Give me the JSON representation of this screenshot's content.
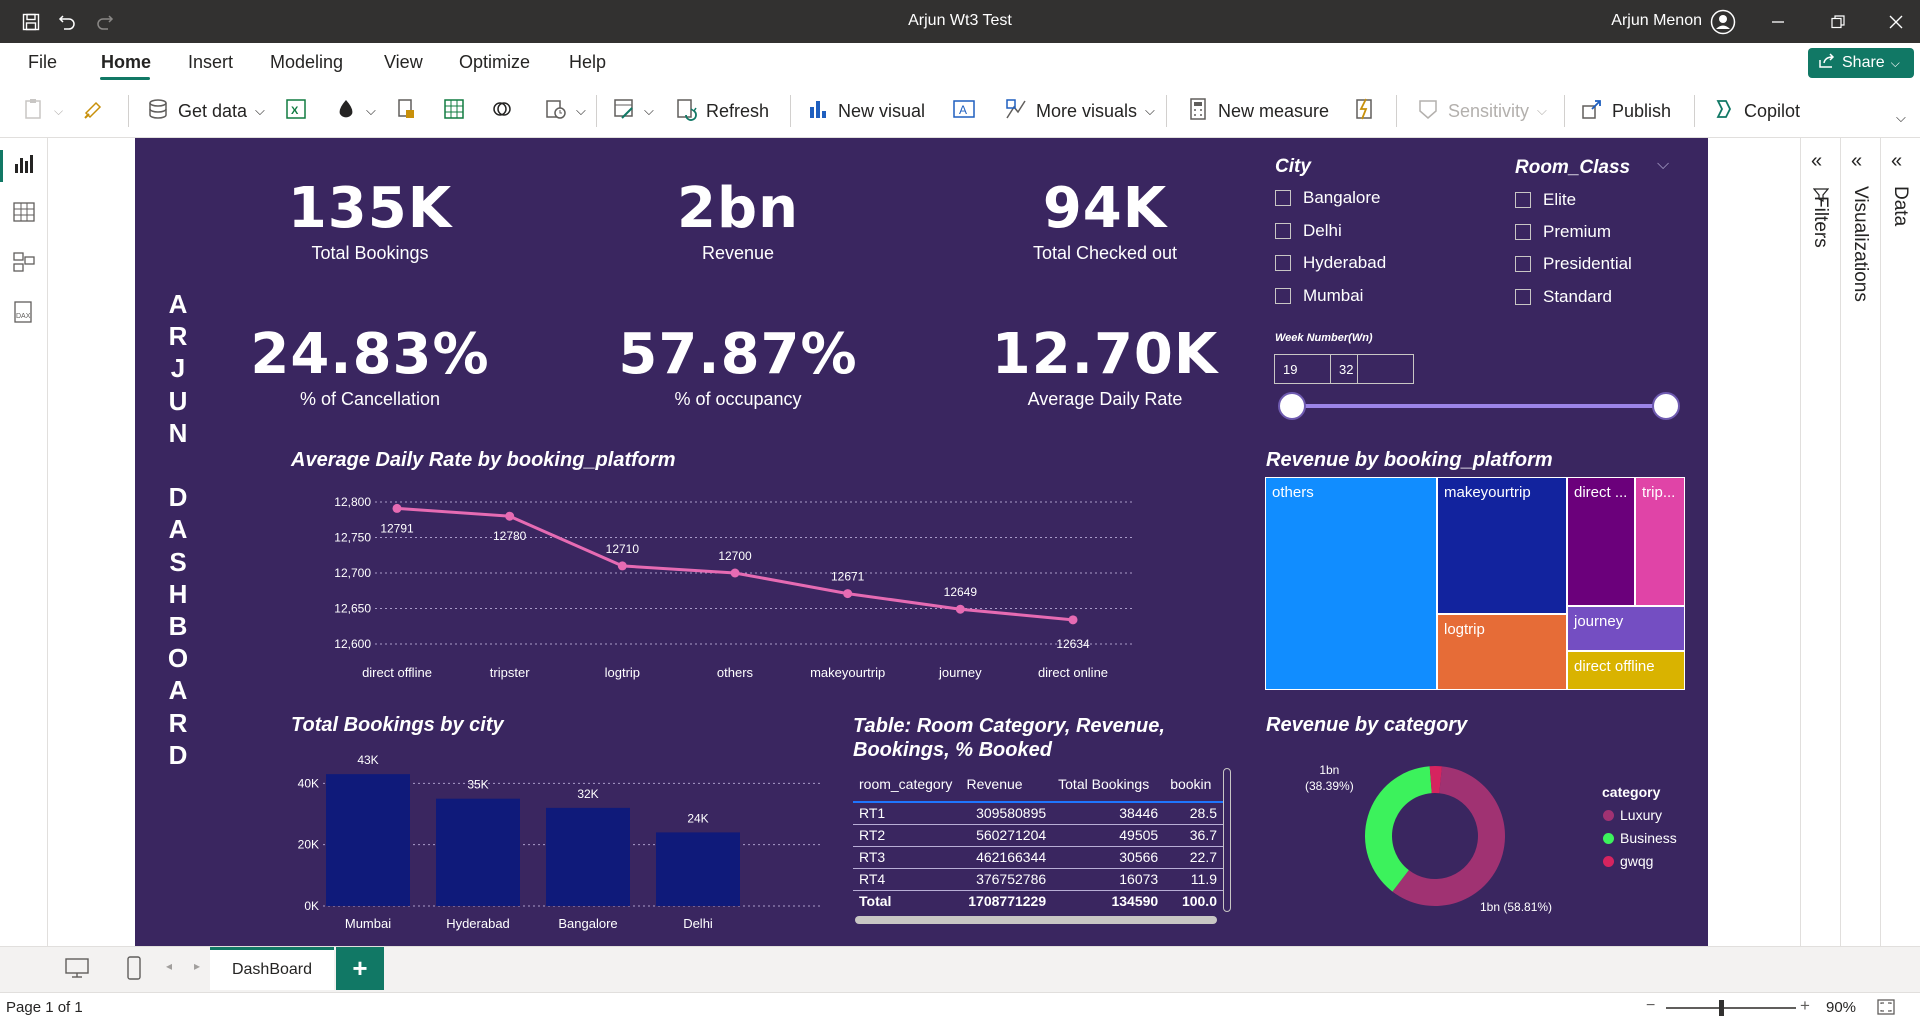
{
  "window": {
    "title": "Arjun Wt3 Test",
    "user": "Arjun Menon"
  },
  "menu": {
    "items": [
      "File",
      "Home",
      "Insert",
      "Modeling",
      "View",
      "Optimize",
      "Help"
    ],
    "active": "Home",
    "share_label": "Share"
  },
  "ribbon": {
    "get_data": "Get data",
    "refresh": "Refresh",
    "new_visual": "New visual",
    "more_visuals": "More visuals",
    "new_measure": "New measure",
    "sensitivity": "Sensitivity",
    "publish": "Publish",
    "copilot": "Copilot"
  },
  "dashboard": {
    "vertical_title": "A\nR\nJ\nU\nN\n\nD\nA\nS\nH\nB\nO\nA\nR\nD",
    "kpis": {
      "total_bookings": {
        "value": "135K",
        "label": "Total Bookings"
      },
      "revenue": {
        "value": "2bn",
        "label": "Revenue"
      },
      "checked_out": {
        "value": "94K",
        "label": "Total Checked out"
      },
      "cancellation": {
        "value": "24.83%",
        "label": "% of Cancellation"
      },
      "occupancy": {
        "value": "57.87%",
        "label": "% of occupancy"
      },
      "adr": {
        "value": "12.70K",
        "label": "Average Daily Rate"
      }
    },
    "slicers": {
      "city": {
        "title": "City",
        "items": [
          "Bangalore",
          "Delhi",
          "Hyderabad",
          "Mumbai"
        ]
      },
      "room_class": {
        "title": "Room_Class",
        "items": [
          "Elite",
          "Premium",
          "Presidential",
          "Standard"
        ]
      },
      "week": {
        "label": "Week Number(Wn)",
        "min": "19",
        "max": "32"
      }
    },
    "line_title": "Average Daily Rate by booking_platform",
    "treemap_title": "Revenue by booking_platform",
    "treemap_labels": [
      "others",
      "makeyourtrip",
      "direct ...",
      "trip...",
      "logtrip",
      "journey",
      "direct offline"
    ],
    "bar_title": "Total Bookings by city",
    "table": {
      "title": "Table: Room Category, Revenue, Bookings, % Booked",
      "headers": [
        "room_category",
        "Revenue",
        "Total Bookings",
        "bookin"
      ],
      "rows": [
        [
          "RT1",
          "309580895",
          "38446",
          "28.5"
        ],
        [
          "RT2",
          "560271204",
          "49505",
          "36.7"
        ],
        [
          "RT3",
          "462166344",
          "30566",
          "22.7"
        ],
        [
          "RT4",
          "376752786",
          "16073",
          "11.9"
        ]
      ],
      "total": [
        "Total",
        "1708771229",
        "134590",
        "100.0"
      ]
    },
    "donut_title": "Revenue by category",
    "donut_labels": {
      "business": "1bn\n(38.39%)",
      "luxury": "1bn (58.81%)"
    },
    "legend": {
      "title": "category",
      "items": [
        "Luxury",
        "Business",
        "gwqg"
      ]
    }
  },
  "panes": {
    "filters": "Filters",
    "visualizations": "Visualizations",
    "data": "Data"
  },
  "page_tabs": {
    "tab": "DashBoard",
    "add": "+"
  },
  "status": {
    "page": "Page 1 of 1",
    "zoom": "90%"
  },
  "colors": {
    "report_bg": "#3a2660",
    "accent": "#117865",
    "line": "#e66bb3",
    "bar": "#0f1a7a",
    "luxury": "#a03272",
    "business": "#3cf25c",
    "gwqg": "#d6245f"
  },
  "chart_data": [
    {
      "type": "line",
      "title": "Average Daily Rate by booking_platform",
      "categories": [
        "direct offline",
        "tripster",
        "logtrip",
        "others",
        "makeyourtrip",
        "journey",
        "direct online"
      ],
      "values": [
        12791,
        12780,
        12710,
        12700,
        12671,
        12649,
        12634
      ],
      "data_labels": [
        "12791",
        "12780",
        "12710",
        "12700",
        "12671",
        "12649",
        "12634"
      ],
      "yticks": [
        "12,600",
        "12,650",
        "12,700",
        "12,750",
        "12,800"
      ],
      "ylim": [
        12600,
        12800
      ],
      "grid": true
    },
    {
      "type": "bar",
      "title": "Total Bookings by city",
      "categories": [
        "Mumbai",
        "Hyderabad",
        "Bangalore",
        "Delhi"
      ],
      "values": [
        43,
        35,
        32,
        24
      ],
      "data_labels": [
        "43K",
        "35K",
        "32K",
        "24K"
      ],
      "yticks": [
        "0K",
        "20K",
        "40K"
      ],
      "ylim": [
        0,
        45
      ],
      "grid": true
    },
    {
      "type": "pie",
      "title": "Revenue by category",
      "categories": [
        "Luxury",
        "Business",
        "gwqg"
      ],
      "values": [
        58.81,
        38.39,
        2.8
      ]
    },
    {
      "type": "treemap",
      "title": "Revenue by booking_platform",
      "categories": [
        "others",
        "makeyourtrip",
        "direct online",
        "tripster",
        "logtrip",
        "journey",
        "direct offline"
      ]
    }
  ]
}
